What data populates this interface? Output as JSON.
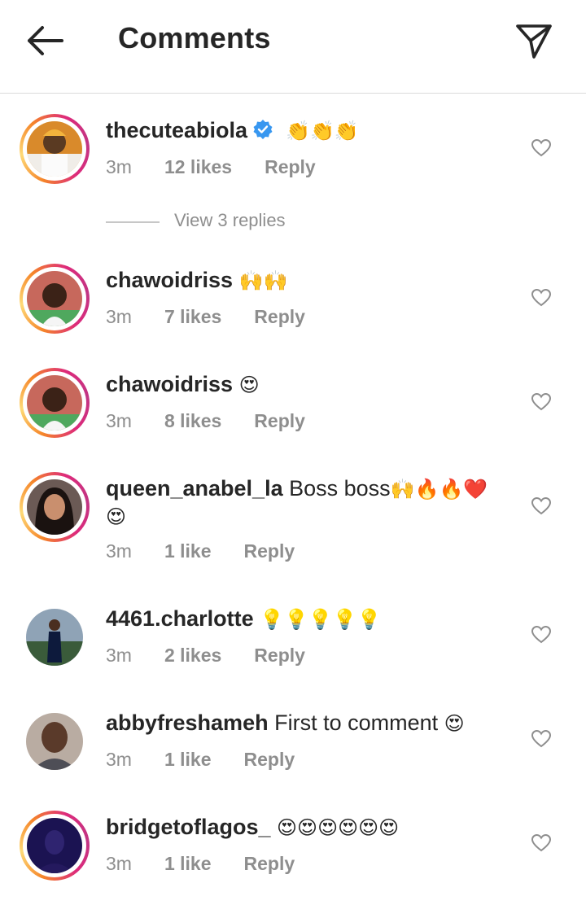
{
  "header": {
    "title": "Comments",
    "back_icon": "arrow-left-icon",
    "send_icon": "paper-plane-icon"
  },
  "view_replies": "View 3 replies",
  "comments": [
    {
      "username": "thecuteabiola",
      "verified": true,
      "text": "",
      "emojis": "👏👏👏",
      "time": "3m",
      "likes": "12 likes",
      "reply": "Reply",
      "story_ring": true
    },
    {
      "username": "chawoidriss",
      "verified": false,
      "text": "",
      "emojis": "🙌🙌",
      "time": "3m",
      "likes": "7 likes",
      "reply": "Reply",
      "story_ring": true
    },
    {
      "username": "chawoidriss",
      "verified": false,
      "text": "",
      "emojis": "😍",
      "time": "3m",
      "likes": "8 likes",
      "reply": "Reply",
      "story_ring": true
    },
    {
      "username": "queen_anabel_la",
      "verified": false,
      "text": "Boss boss",
      "emojis": "🙌🔥🔥❤️",
      "emojis_line2": "😍",
      "time": "3m",
      "likes": "1 like",
      "reply": "Reply",
      "story_ring": true
    },
    {
      "username": "4461.charlotte",
      "verified": false,
      "text": "",
      "emojis": "💡💡💡💡💡",
      "time": "3m",
      "likes": "2 likes",
      "reply": "Reply",
      "story_ring": false
    },
    {
      "username": "abbyfreshameh",
      "verified": false,
      "text": "First to comment",
      "emojis": "😍",
      "time": "3m",
      "likes": "1 like",
      "reply": "Reply",
      "story_ring": false
    },
    {
      "username": "bridgetoflagos_",
      "verified": false,
      "text": "",
      "emojis": "😍😍😍😍😍😍",
      "time": "3m",
      "likes": "1 like",
      "reply": "Reply",
      "story_ring": true
    }
  ]
}
